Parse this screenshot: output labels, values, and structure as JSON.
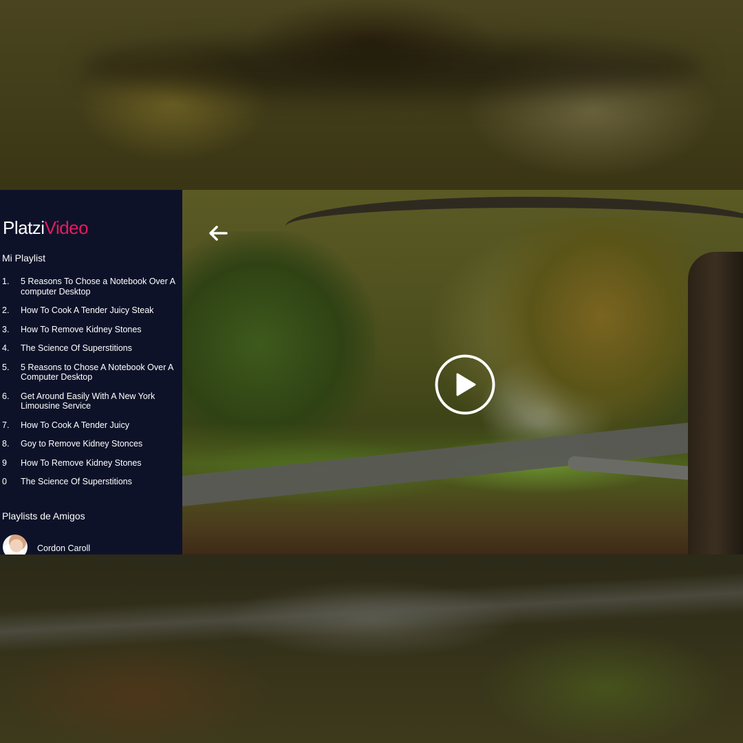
{
  "logo": {
    "part1": "Platzi",
    "part2": "Video"
  },
  "my_playlist": {
    "title": "Mi Playlist",
    "items": [
      {
        "num": "1.",
        "title": "5 Reasons To Chose a Notebook Over A computer Desktop"
      },
      {
        "num": "2.",
        "title": "How To Cook A Tender Juicy Steak"
      },
      {
        "num": "3.",
        "title": "How To Remove Kidney Stones"
      },
      {
        "num": "4.",
        "title": "The Science Of Superstitions"
      },
      {
        "num": "5.",
        "title": "5 Reasons to Chose A Notebook Over A Computer Desktop"
      },
      {
        "num": "6.",
        "title": "Get Around Easily With A New York Limousine Service"
      },
      {
        "num": "7.",
        "title": "How To Cook A Tender Juicy"
      },
      {
        "num": "8.",
        "title": "Goy to Remove Kidney Stonces"
      },
      {
        "num": "9",
        "title": "How To Remove Kidney Stones"
      },
      {
        "num": "0",
        "title": "The Science Of Superstitions"
      }
    ]
  },
  "friends": {
    "title": "Playlists de Amigos",
    "items": [
      {
        "name": "Cordon Caroll"
      }
    ]
  },
  "video": {
    "back_icon": "arrow-left-icon",
    "play_icon": "play-circle-icon"
  },
  "colors": {
    "sidebar_bg": "#0e1229",
    "brand_accent": "#e8195d",
    "text": "#ffffff"
  }
}
